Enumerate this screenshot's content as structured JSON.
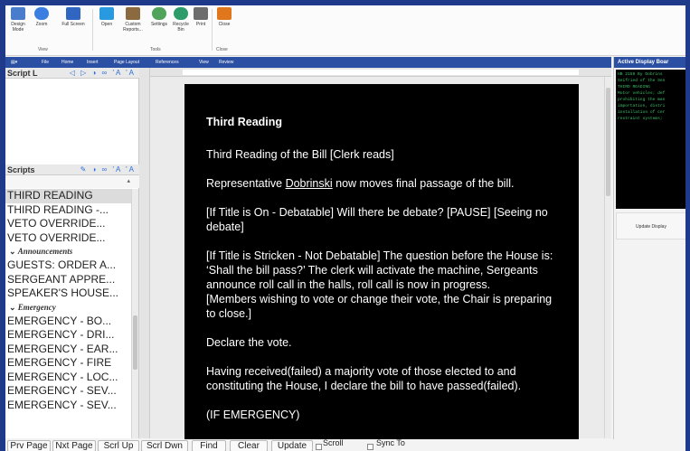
{
  "ribbon": {
    "buttons": [
      {
        "label": "Design Mode",
        "color": "#4a7ccc"
      },
      {
        "label": "Zoom",
        "color": "#3b7de0"
      },
      {
        "label": "Full Screen",
        "color": "#2f66c2"
      },
      {
        "label": "Open",
        "color": "#2a9ae0"
      },
      {
        "label": "Custom Reports...",
        "color": "#8a6a3e"
      },
      {
        "label": "Settings",
        "color": "#4fa35a"
      },
      {
        "label": "Recycle Bin",
        "color": "#2e9c6a"
      },
      {
        "label": "Print",
        "color": "#6d6d6d"
      },
      {
        "label": "Close",
        "color": "#e0771c"
      }
    ],
    "groups": {
      "view": "View",
      "tools": "Tools",
      "close": "Close"
    }
  },
  "menu": [
    "File",
    "Home",
    "Insert",
    "Page Layout",
    "References",
    "View",
    "Review"
  ],
  "left_panel": {
    "script_header": "Script L",
    "scripts_header": "Scripts",
    "items": [
      {
        "type": "item",
        "label": "THIRD READING",
        "selected": true
      },
      {
        "type": "item",
        "label": "THIRD READING -..."
      },
      {
        "type": "item",
        "label": "VETO OVERRIDE..."
      },
      {
        "type": "item",
        "label": "VETO OVERRIDE..."
      },
      {
        "type": "cat",
        "label": "Announcements"
      },
      {
        "type": "item",
        "label": "GUESTS: ORDER A..."
      },
      {
        "type": "item",
        "label": "SERGEANT APPRE..."
      },
      {
        "type": "item",
        "label": "SPEAKER'S HOUSE..."
      },
      {
        "type": "cat",
        "label": "Emergency"
      },
      {
        "type": "item",
        "label": "EMERGENCY - BO..."
      },
      {
        "type": "item",
        "label": "EMERGENCY - DRI..."
      },
      {
        "type": "item",
        "label": "EMERGENCY - EAR..."
      },
      {
        "type": "item",
        "label": "EMERGENCY - FIRE"
      },
      {
        "type": "item",
        "label": "EMERGENCY - LOC..."
      },
      {
        "type": "item",
        "label": "EMERGENCY - SEV..."
      },
      {
        "type": "item",
        "label": "EMERGENCY - SEV..."
      }
    ]
  },
  "document": {
    "title": "Third Reading",
    "p1": "Third Reading of the Bill [Clerk reads]",
    "p2_a": "Representative ",
    "p2_name": "Dobrinski",
    "p2_b": " now moves final passage of the bill.",
    "p3": "[If Title is On - Debatable] Will there be debate? [PAUSE]  [Seeing no debate]",
    "p4": "[If Title is Stricken - Not Debatable] The question before the House is: ‘Shall the bill pass?’  The clerk will activate the machine, Sergeants announce roll call in the halls, roll call is now in progress.",
    "p4b": "[Members wishing to vote or change their vote, the Chair is preparing to close.]",
    "p5": "Declare the vote.",
    "p6": "Having received(failed) a majority vote of those elected to and constituting the House, I declare the bill to have passed(failed).",
    "p7": "(IF EMERGENCY)"
  },
  "right_panel": {
    "header": "Active Display Boar",
    "lines": [
      "HB 2159  By Dobrins",
      "Seifried of the Sen",
      "THIRD READING",
      "Motor vehicles; def",
      "prohibiting the man",
      "importation, distri",
      "installation of cer",
      "restraint systems;"
    ],
    "update_label": "Update Display"
  },
  "bottom": {
    "prev": "Prv Page",
    "next": "Nxt Page",
    "scrl_up": "Scrl Up",
    "scrl_dwn": "Scrl Dwn",
    "find": "Find",
    "clear": "Clear",
    "update": "Update",
    "scroll_label": "Scroll",
    "sync_label": "Sync To"
  }
}
